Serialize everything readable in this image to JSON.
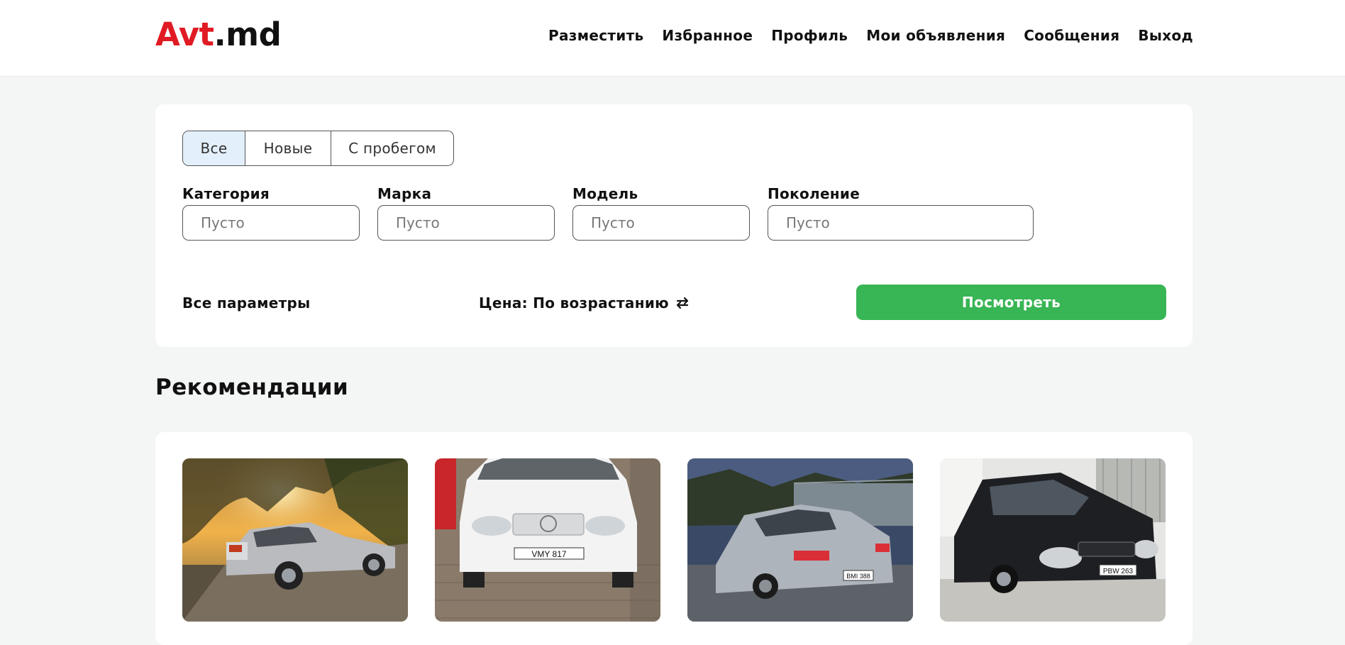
{
  "header": {
    "logo_part1": "Avt",
    "logo_part2": ".md",
    "nav": [
      "Разместить",
      "Избранное",
      "Профиль",
      "Мои объявления",
      "Сообщения",
      "Выход"
    ]
  },
  "filters": {
    "segments": [
      "Все",
      "Новые",
      "С пробегом"
    ],
    "fields": [
      {
        "label": "Категория",
        "placeholder": "Пусто"
      },
      {
        "label": "Марка",
        "placeholder": "Пусто"
      },
      {
        "label": "Модель",
        "placeholder": "Пусто"
      },
      {
        "label": "Поколение",
        "placeholder": "Пусто"
      }
    ],
    "all_params": "Все параметры",
    "sort_label": "Цена: По возрастанию",
    "submit": "Посмотреть"
  },
  "recommendations": {
    "title": "Рекомендации",
    "cars": [
      {
        "name": "silver-hatchback-sunset",
        "plate": ""
      },
      {
        "name": "white-vw-golf",
        "plate": "VMY 817"
      },
      {
        "name": "silver-peugeot-sedan",
        "plate": "BMI 388"
      },
      {
        "name": "black-lada-priora",
        "plate": "PBW 263"
      }
    ]
  },
  "colors": {
    "brand_red": "#e01b24",
    "accent_green": "#38b554",
    "active_segment": "#e3effb"
  }
}
